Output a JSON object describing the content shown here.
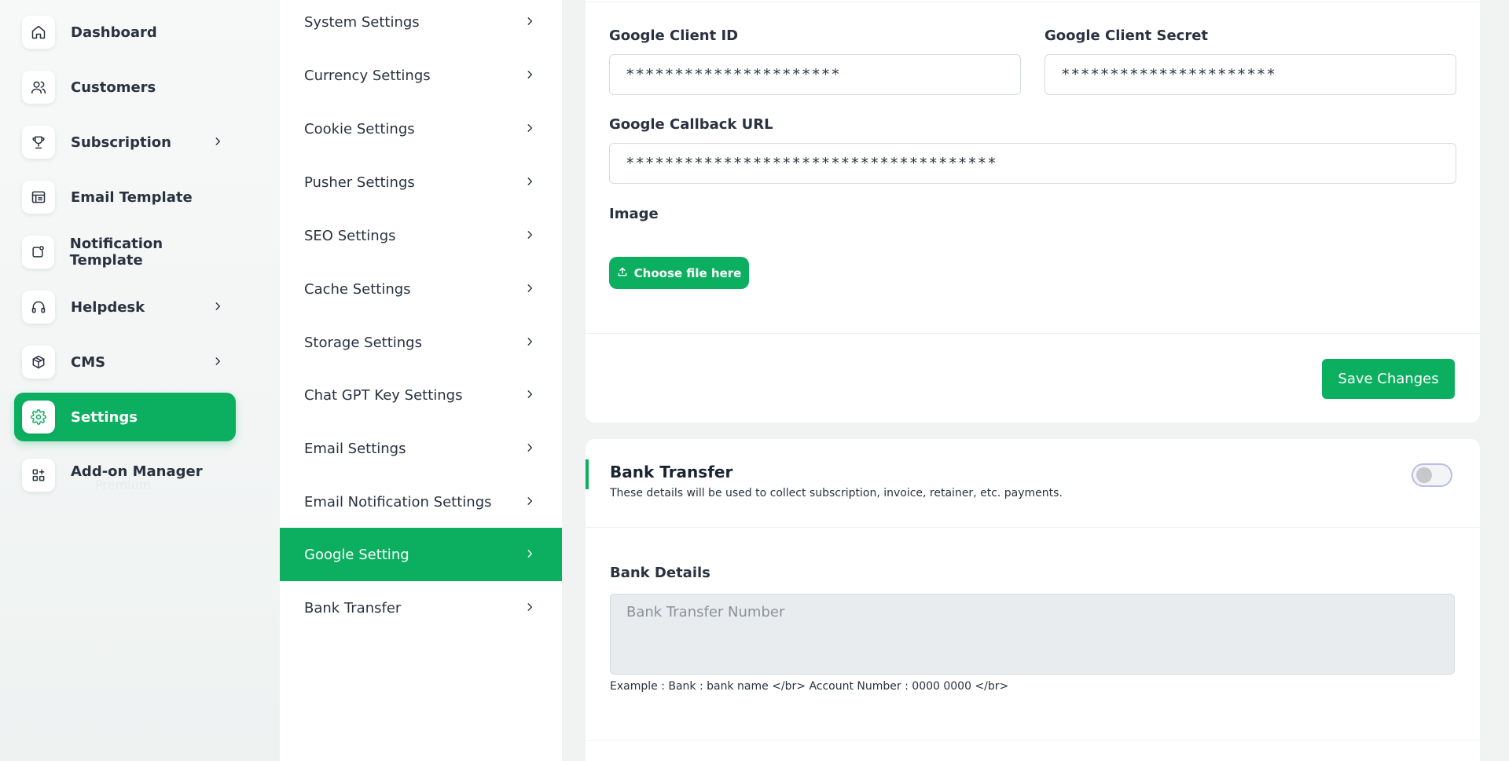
{
  "sidebar": {
    "items": [
      {
        "label": "Dashboard",
        "icon": "home-icon",
        "has_chevron": false,
        "active": false
      },
      {
        "label": "Customers",
        "icon": "users-icon",
        "has_chevron": false,
        "active": false
      },
      {
        "label": "Subscription",
        "icon": "trophy-icon",
        "has_chevron": true,
        "active": false
      },
      {
        "label": "Email Template",
        "icon": "template-icon",
        "has_chevron": false,
        "active": false
      },
      {
        "label": "Notification Template",
        "icon": "notification-icon",
        "has_chevron": false,
        "active": false
      },
      {
        "label": "Helpdesk",
        "icon": "headphones-icon",
        "has_chevron": true,
        "active": false
      },
      {
        "label": "CMS",
        "icon": "box-icon",
        "has_chevron": true,
        "active": false
      },
      {
        "label": "Settings",
        "icon": "gear-icon",
        "has_chevron": false,
        "active": true
      },
      {
        "label": "Add-on Manager",
        "icon": "apps-add-icon",
        "has_chevron": false,
        "active": false
      }
    ],
    "addon_sub_label": "Premium"
  },
  "settings_menu": {
    "items": [
      {
        "label": "System Settings",
        "active": false
      },
      {
        "label": "Currency Settings",
        "active": false
      },
      {
        "label": "Cookie Settings",
        "active": false
      },
      {
        "label": "Pusher Settings",
        "active": false
      },
      {
        "label": "SEO Settings",
        "active": false
      },
      {
        "label": "Cache Settings",
        "active": false
      },
      {
        "label": "Storage Settings",
        "active": false
      },
      {
        "label": "Chat GPT Key Settings",
        "active": false
      },
      {
        "label": "Email Settings",
        "active": false
      },
      {
        "label": "Email Notification Settings",
        "active": false
      },
      {
        "label": "Google Setting",
        "active": true
      },
      {
        "label": "Bank Transfer",
        "active": false
      }
    ]
  },
  "google": {
    "client_id_label": "Google Client ID",
    "client_id_value": "**********************",
    "client_secret_label": "Google Client Secret",
    "client_secret_value": "**********************",
    "callback_label": "Google Callback URL",
    "callback_value": "**************************************",
    "image_label": "Image",
    "choose_file_label": "Choose file here",
    "save_label": "Save Changes"
  },
  "bank": {
    "title": "Bank Transfer",
    "description": "These details will be used to collect subscription, invoice, retainer, etc. payments.",
    "enabled": false,
    "details_label": "Bank Details",
    "details_placeholder": "Bank Transfer Number",
    "hint": "Example : Bank : bank name </br> Account Number : 0000 0000 </br>"
  },
  "colors": {
    "accent": "#0caf60",
    "text": "#293240",
    "background": "#f0f3f2"
  }
}
